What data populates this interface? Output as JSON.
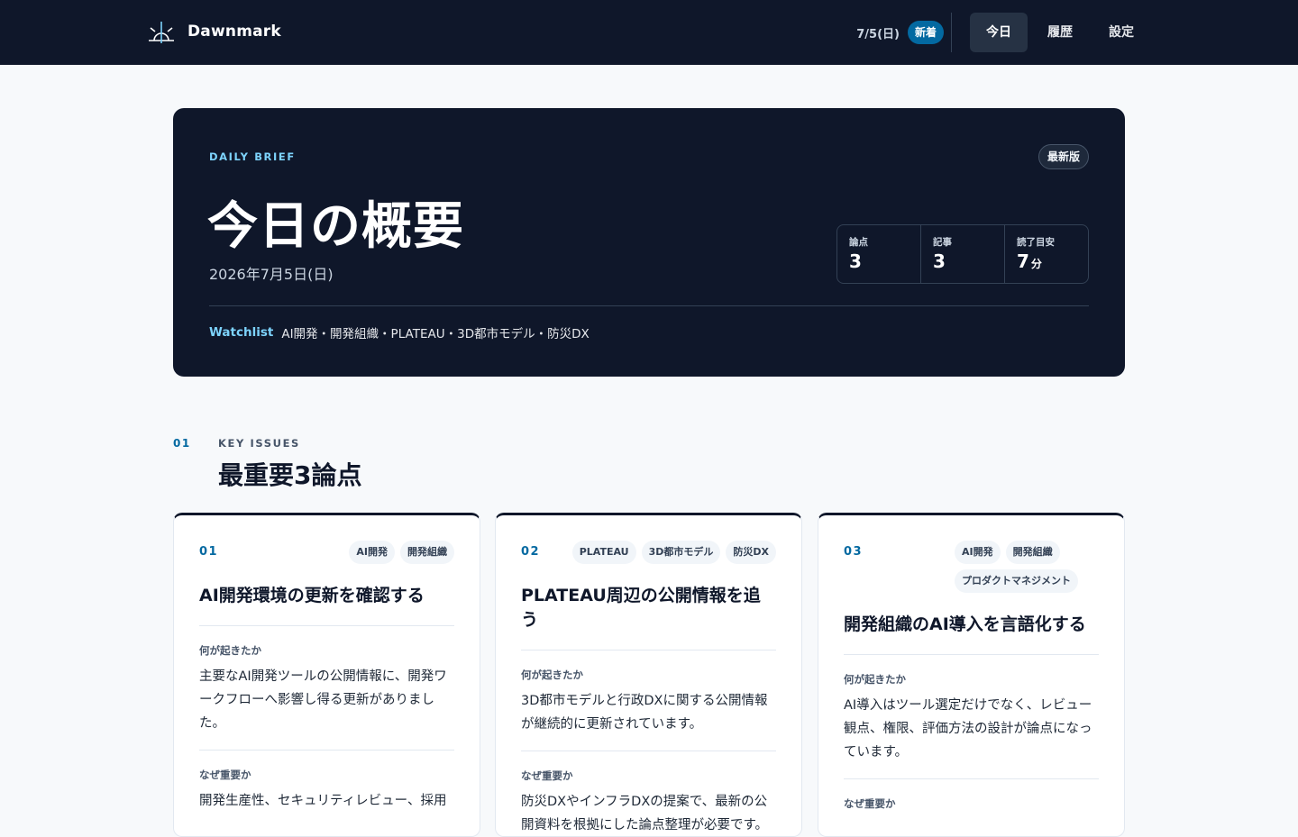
{
  "app": {
    "name": "Dawnmark",
    "logo_icon": "sunrise-icon"
  },
  "header": {
    "date": "7/5(日)",
    "badge": "新着",
    "nav": [
      {
        "label": "今日",
        "active": true
      },
      {
        "label": "履歴",
        "active": false
      },
      {
        "label": "設定",
        "active": false
      }
    ]
  },
  "hero": {
    "kicker": "DAILY BRIEF",
    "pill": "最新版",
    "title": "今日の概要",
    "date": "2026年7月5日(日)",
    "stats": [
      {
        "label": "論点",
        "value": "3",
        "unit": ""
      },
      {
        "label": "記事",
        "value": "3",
        "unit": ""
      },
      {
        "label": "読了目安",
        "value": "7",
        "unit": "分"
      }
    ],
    "watchlist_label": "Watchlist",
    "watchlist": "AI開発・開発組織・PLATEAU・3D都市モデル・防災DX"
  },
  "section": {
    "num": "01",
    "kicker": "KEY ISSUES",
    "title": "最重要3論点"
  },
  "cards": [
    {
      "num": "01",
      "tags": [
        "AI開発",
        "開発組織"
      ],
      "title": "AI開発環境の更新を確認する",
      "what_label": "何が起きたか",
      "what": "主要なAI開発ツールの公開情報に、開発ワークフローへ影響し得る更新がありました。",
      "why_label": "なぜ重要か",
      "why": "開発生産性、セキュリティレビュー、採用"
    },
    {
      "num": "02",
      "tags": [
        "PLATEAU",
        "3D都市モデル",
        "防災DX"
      ],
      "title": "PLATEAU周辺の公開情報を追う",
      "what_label": "何が起きたか",
      "what": "3D都市モデルと行政DXに関する公開情報が継続的に更新されています。",
      "why_label": "なぜ重要か",
      "why": "防災DXやインフラDXの提案で、最新の公開資料を根拠にした論点整理が必要です。"
    },
    {
      "num": "03",
      "tags": [
        "AI開発",
        "開発組織",
        "プロダクトマネジメント"
      ],
      "title": "開発組織のAI導入を言語化する",
      "what_label": "何が起きたか",
      "what": "AI導入はツール選定だけでなく、レビュー観点、権限、評価方法の設計が論点になっています。",
      "why_label": "なぜ重要か",
      "why": ""
    }
  ],
  "colors": {
    "navy": "#0f172a",
    "accent": "#0369a1",
    "sky": "#7dd3fc"
  }
}
